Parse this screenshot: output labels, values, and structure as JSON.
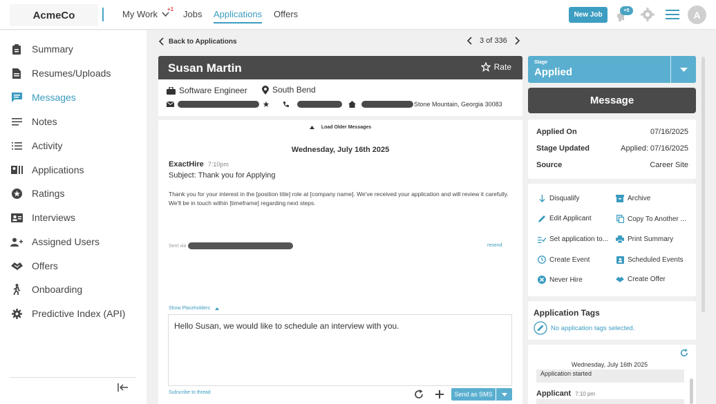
{
  "topbar": {
    "logo": "AcmeCo",
    "nav": [
      {
        "label": "My Work",
        "badge": "+1"
      },
      {
        "label": "Jobs"
      },
      {
        "label": "Applications"
      },
      {
        "label": "Offers"
      }
    ],
    "new_job_label": "New Job",
    "notification_badge": "+5",
    "avatar_initial": "A",
    "accent_color": "#3a9bbf"
  },
  "sidebar": {
    "items": [
      {
        "label": "Summary",
        "icon": "clipboard-icon"
      },
      {
        "label": "Resumes/Uploads",
        "icon": "document-icon"
      },
      {
        "label": "Messages",
        "icon": "chat-icon",
        "active": true
      },
      {
        "label": "Notes",
        "icon": "notes-icon"
      },
      {
        "label": "Activity",
        "icon": "list-icon"
      },
      {
        "label": "Applications",
        "icon": "applications-icon"
      },
      {
        "label": "Ratings",
        "icon": "star-circle-icon"
      },
      {
        "label": "Interviews",
        "icon": "person-card-icon"
      },
      {
        "label": "Assigned Users",
        "icon": "add-user-icon"
      },
      {
        "label": "Offers",
        "icon": "handshake-icon"
      },
      {
        "label": "Onboarding",
        "icon": "walking-icon"
      },
      {
        "label": "Predictive Index (API)",
        "icon": "gear-icon"
      }
    ]
  },
  "navbar": {
    "back_label": "Back to Applications",
    "pager_text": "3 of 336"
  },
  "applicant": {
    "name": "Susan Martin",
    "rate_label": "Rate",
    "job_title": "Software Engineer",
    "location": "South Bend",
    "address_suffix": "Stone Mountain, Georgia 30083"
  },
  "messages": {
    "load_older": "Load Older Messages",
    "date_header": "Wednesday, July 16th 2025",
    "sender": "ExactHire",
    "time": "7:10pm",
    "subject": "Subject: Thank you for Applying",
    "body": "Thank you for your interest in the [position title] role at [company name]. We've received your application and will review it carefully. We'll be in touch within [timeframe] regarding next steps.",
    "sent_via_label": "Sent via",
    "resend_label": "resend",
    "show_placeholders": "Show Placeholders",
    "composer_text": "Hello Susan, we would like to schedule an interview with you.",
    "subscribe_label": "Subscribe to thread",
    "send_sms_label": "Send as SMS"
  },
  "stage": {
    "caption": "Stage",
    "value": "Applied"
  },
  "message_button_label": "Message",
  "details": {
    "applied_on_label": "Applied On",
    "applied_on": "07/16/2025",
    "stage_updated_label": "Stage Updated",
    "stage_updated": "Applied: 07/16/2025",
    "source_label": "Source",
    "source": "Career Site"
  },
  "actions": {
    "disqualify": "Disqualify",
    "archive": "Archive",
    "edit_applicant": "Edit Applicant",
    "copy_to_another": "Copy To Another ...",
    "set_application_to": "Set application to...",
    "print_summary": "Print Summary",
    "create_event": "Create Event",
    "scheduled_events": "Scheduled Events",
    "never_hire": "Never Hire",
    "create_offer": "Create Offer"
  },
  "tags": {
    "title": "Application Tags",
    "empty_text": "No application tags selected."
  },
  "activity_feed": {
    "date": "Wednesday, July 16th 2025",
    "started": "Application started",
    "actor": "Applicant",
    "time": "7:10 pm"
  }
}
